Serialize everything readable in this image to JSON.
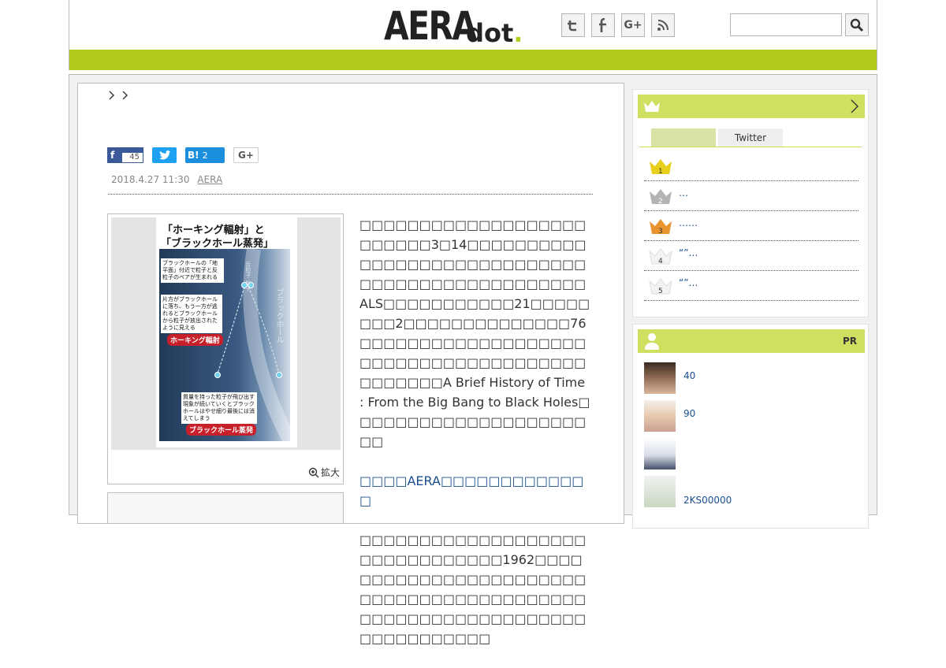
{
  "header": {
    "logo_main": "AERA",
    "logo_sub": "dot",
    "logo_period": ".",
    "social": [
      {
        "icon": "twitter-icon",
        "glyph": "t"
      },
      {
        "icon": "facebook-icon",
        "glyph": "f"
      },
      {
        "icon": "google-plus-icon",
        "glyph": "G+"
      },
      {
        "icon": "rss-icon",
        "glyph": "rss"
      }
    ],
    "search_placeholder": ""
  },
  "colors": {
    "nav_green": "#b2ca1c",
    "widget_green": "#cfe060",
    "link_blue": "#1a4f8f"
  },
  "article": {
    "breadcrumb_sep": "> >",
    "share": {
      "facebook_count": "45",
      "hatena_label": "B!",
      "hatena_count": "2",
      "gplus_label": "G+"
    },
    "date": "2018.4.27 11:30",
    "source": "AERA",
    "figure": {
      "title_line1": "「ホーキング輻射」と",
      "title_line2": "「ブラックホール蒸発」",
      "box1": "ブラックホールの「地平面」付近で粒子と反粒子のペアが生まれる",
      "box2": "片方がブラックホールに落ち、もう一方が逃れるとブラックホールから粒子が放出されたように見える",
      "label_radiation": "ホーキング輻射",
      "box3": "質量を持った粒子が飛び出す現象が続いていくとブラックホールはやせ細り最後には消えてしまう",
      "label_evaporation": "ブラックホール蒸発",
      "vertical_label": "ブラックホール",
      "particle_label": "反粒子 粒子",
      "zoom_label": "拡大"
    },
    "paragraphs": [
      "□□□□□□□□□□□□□□□□□□□□□□□□□3□14□□□□□□□□□□□□□□□□□□□□□□□□□□□□□□□□□□□□□□□□□□□□□□□□ALS□□□□□□□□□□□21□□□□□□□□2□□□□□□□□□□□□□□76□□□□□□□□□□□□□□□□□□□□□□□□□□□□□□□□□□□□□□□□□□□□□A Brief History of Time : From the Big Bang to Black Holes□□□□□□□□□□□□□□□□□□□□□□",
      "□□□□AERA□□□□□□□□□□□□□",
      "□□□□□□□□□□□□□□□□□□□□□□□□□□□□□□□1962□□□□□□□□□□□□□□□□□□□□□□□□□□□□□□□□□□□□□□□□□□□□□□□□□□□□□□□□□□□□□□□□□□□□□□□□"
    ]
  },
  "sidebar": {
    "ranking": {
      "tabs": [
        "",
        "Twitter"
      ],
      "items": [
        {
          "rank": "1",
          "text": ""
        },
        {
          "rank": "2",
          "text": "…"
        },
        {
          "rank": "3",
          "text": "……"
        },
        {
          "rank": "4",
          "text": "“”…"
        },
        {
          "rank": "5",
          "text": "“”…"
        }
      ]
    },
    "people": {
      "label": "PR",
      "items": [
        {
          "text": "40"
        },
        {
          "text": "90"
        },
        {
          "text": ""
        },
        {
          "text": "2KS00000"
        }
      ]
    }
  }
}
